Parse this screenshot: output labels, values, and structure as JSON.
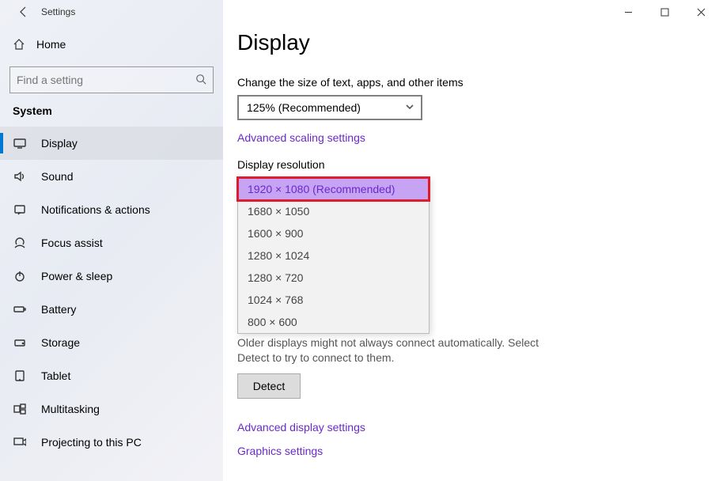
{
  "window": {
    "title": "Settings"
  },
  "sidebar": {
    "home_label": "Home",
    "search_placeholder": "Find a setting",
    "category_label": "System",
    "items": [
      {
        "label": "Display"
      },
      {
        "label": "Sound"
      },
      {
        "label": "Notifications & actions"
      },
      {
        "label": "Focus assist"
      },
      {
        "label": "Power & sleep"
      },
      {
        "label": "Battery"
      },
      {
        "label": "Storage"
      },
      {
        "label": "Tablet"
      },
      {
        "label": "Multitasking"
      },
      {
        "label": "Projecting to this PC"
      }
    ]
  },
  "main": {
    "heading": "Display",
    "scale_label": "Change the size of text, apps, and other items",
    "scale_value": "125% (Recommended)",
    "adv_scaling_link": "Advanced scaling settings",
    "resolution_label": "Display resolution",
    "resolutions": [
      "1920 × 1080 (Recommended)",
      "1680 × 1050",
      "1600 × 900",
      "1280 × 1024",
      "1280 × 720",
      "1024 × 768",
      "800 × 600"
    ],
    "older_text": "Older displays might not always connect automatically. Select Detect to try to connect to them.",
    "detect_label": "Detect",
    "adv_display_link": "Advanced display settings",
    "graphics_link": "Graphics settings"
  }
}
